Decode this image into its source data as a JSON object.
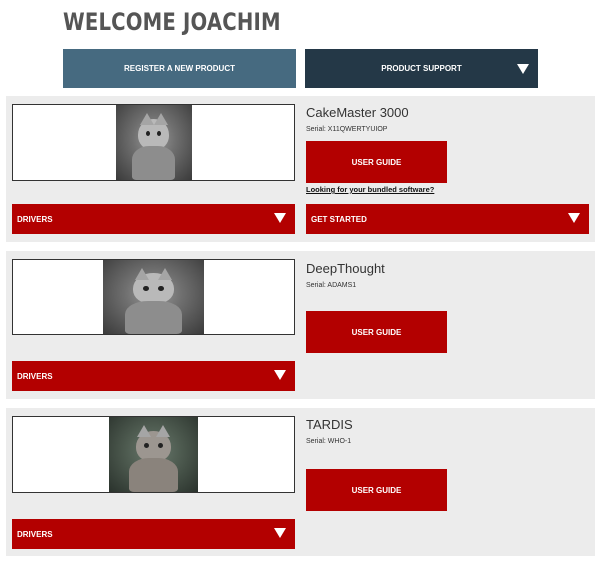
{
  "header": {
    "welcome_text": "WELCOME JOACHIM"
  },
  "top_buttons": {
    "register_label": "REGISTER A NEW PRODUCT",
    "support_label": "PRODUCT SUPPORT"
  },
  "products": [
    {
      "name": "CakeMaster 3000",
      "serial": "Serial: X11QWERTYUIOP",
      "user_guide_label": "USER GUIDE",
      "bundled_link": "Looking for your bundled software?",
      "drivers_label": "DRIVERS",
      "get_started_label": "GET STARTED"
    },
    {
      "name": "DeepThought",
      "serial": "Serial: ADAMS1",
      "user_guide_label": "USER GUIDE",
      "drivers_label": "DRIVERS"
    },
    {
      "name": "TARDIS",
      "serial": "Serial: WHO-1",
      "user_guide_label": "USER GUIDE",
      "drivers_label": "DRIVERS"
    }
  ],
  "colors": {
    "register_button": "#466a80",
    "support_button": "#243847",
    "brand_red": "#b30000",
    "card_background": "#ececec",
    "heading_text": "#555555"
  },
  "icons": {
    "dropdown": "triangle-down-icon",
    "product_image": "kitten-photo"
  }
}
